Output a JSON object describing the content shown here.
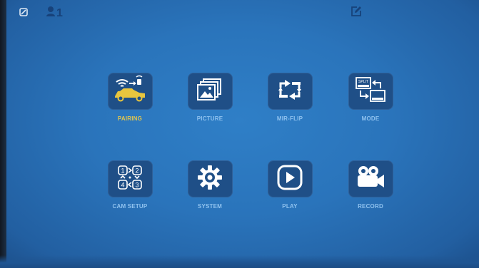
{
  "status_bar": {
    "left_icons": [
      "block-icon",
      "user-icon"
    ],
    "user_count": "1",
    "right_icon": "edit-icon"
  },
  "menu": {
    "items": [
      {
        "label": "PAIRING",
        "icon": "pairing-icon",
        "selected": true
      },
      {
        "label": "PICTURE",
        "icon": "picture-icon"
      },
      {
        "label": "MIR-FLIP",
        "icon": "mir-flip-icon"
      },
      {
        "label": "MODE",
        "icon": "mode-icon",
        "icon_text": "SPLIT"
      },
      {
        "label": "CAM SETUP",
        "icon": "cam-setup-icon",
        "icon_digits": [
          "1",
          "2",
          "4",
          "3"
        ]
      },
      {
        "label": "SYSTEM",
        "icon": "gear-icon"
      },
      {
        "label": "PLAY",
        "icon": "play-icon"
      },
      {
        "label": "RECORD",
        "icon": "record-icon"
      }
    ]
  },
  "colors": {
    "background": "#2a74bb",
    "tile": "#1f4f87",
    "label": "#8fc2ef",
    "label_selected": "#e2c64e",
    "icon_white": "#ffffff",
    "icon_yellow": "#e8c53e"
  }
}
